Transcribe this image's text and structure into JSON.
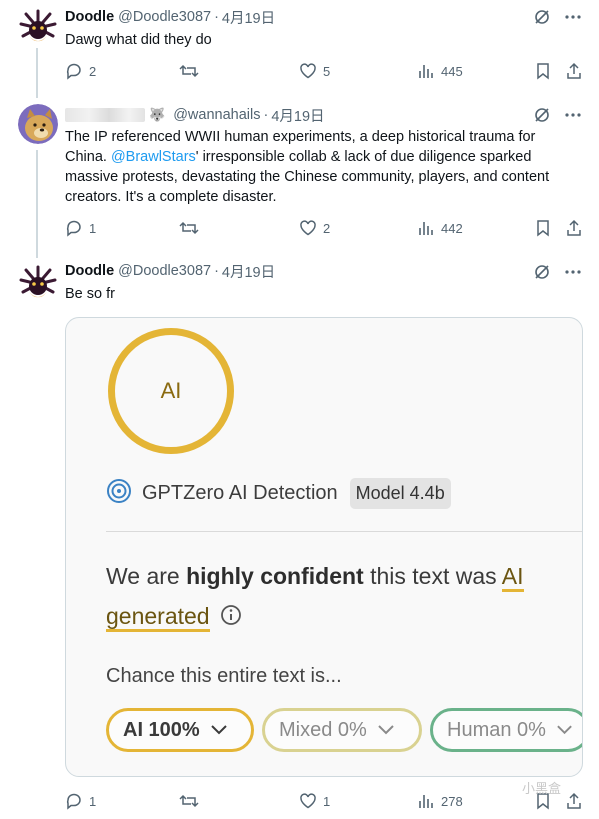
{
  "tweets": [
    {
      "name": "Doodle",
      "handle": "@Doodle3087",
      "date": "4月19日",
      "text": "Dawg what did they do",
      "replies": "2",
      "likes": "5",
      "views": "445",
      "avatar": "urchin-avatar"
    },
    {
      "name": "",
      "handle": "@wannahails",
      "date": "4月19日",
      "text_before": "The IP referenced WWII human experiments, a deep historical trauma for China. ",
      "mention": "@BrawlStars",
      "text_after": "' irresponsible collab & lack of due diligence sparked massive protests, devastating the Chinese community, players, and content creators. It's a complete disaster.",
      "replies": "1",
      "likes": "2",
      "views": "442",
      "avatar": "doge-avatar"
    },
    {
      "name": "Doodle",
      "handle": "@Doodle3087",
      "date": "4月19日",
      "text": "Be so fr",
      "replies": "1",
      "likes": "1",
      "views": "278",
      "avatar": "urchin-avatar"
    }
  ],
  "gptzero_card": {
    "ring_label": "AI",
    "brand": "GPTZero AI Detection",
    "model_badge": "Model 4.4b",
    "verdict_pre": "We are ",
    "verdict_bold": "highly confident",
    "verdict_mid": " this text was ",
    "verdict_ai": "AI",
    "verdict_generated": "generated",
    "chance_label": "Chance this entire text is...",
    "pills": [
      {
        "label": "AI 100%"
      },
      {
        "label": "Mixed 0%"
      },
      {
        "label": "Human 0%"
      }
    ],
    "colors": {
      "ai": "#e4b536",
      "mixed": "#d9d291",
      "human": "#6ab28a"
    }
  },
  "watermark": "小黑盒"
}
